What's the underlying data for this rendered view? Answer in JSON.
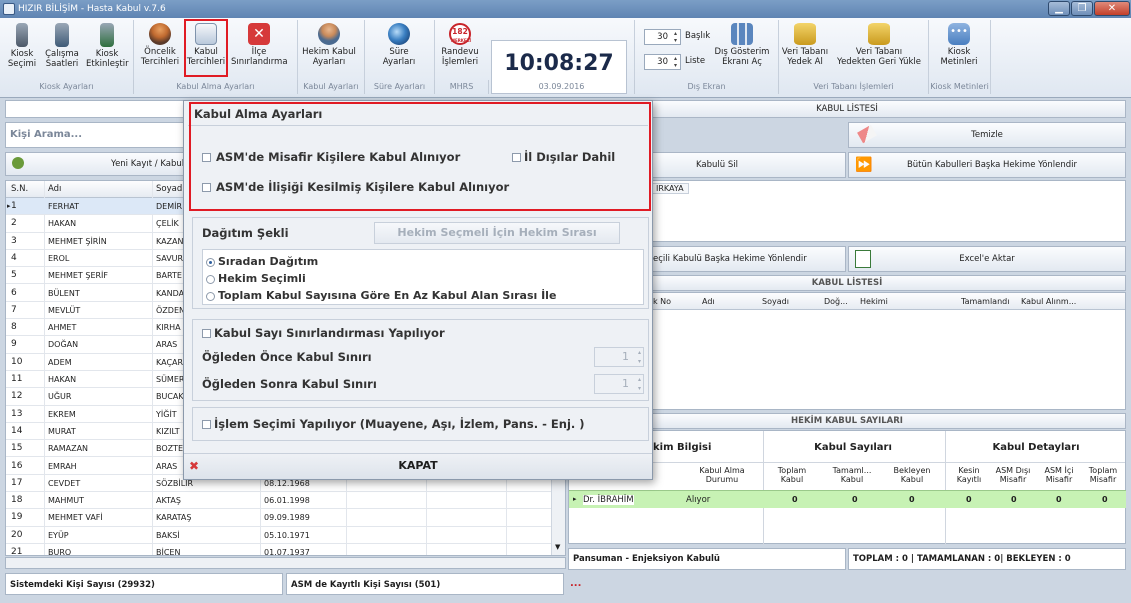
{
  "window": {
    "title": "HIZIR BİLİŞİM - Hasta Kabul v.7.6"
  },
  "ribbon": {
    "buttons": [
      {
        "label1": "Kiosk",
        "label2": "Seçimi"
      },
      {
        "label1": "Çalışma",
        "label2": "Saatleri"
      },
      {
        "label1": "Kiosk",
        "label2": "Etkinleştir"
      },
      {
        "label1": "Öncelik",
        "label2": "Tercihleri"
      },
      {
        "label1": "Kabul",
        "label2": "Tercihleri"
      },
      {
        "label1": "İlçe",
        "label2": "Sınırlandırma"
      },
      {
        "label1": "Hekim Kabul",
        "label2": "Ayarları"
      },
      {
        "label1": "Süre",
        "label2": "Ayarları"
      },
      {
        "label1": "Randevu",
        "label2": "İşlemleri"
      },
      {
        "label1": "Dış Gösterim",
        "label2": "Ekranı Aç"
      },
      {
        "label1": "Veri Tabanı",
        "label2": "Yedek Al"
      },
      {
        "label1": "Veri Tabanı",
        "label2": "Yedekten Geri Yükle"
      },
      {
        "label1": "Kiosk",
        "label2": "Metinleri"
      }
    ],
    "groups": [
      "Kiosk Ayarları",
      "Kabul Alma Ayarları",
      "Kabul Ayarları",
      "Süre Ayarları",
      "MHRS",
      "03.09.2016",
      "Dış Ekran",
      "Veri Tabanı İşlemleri",
      "Kiosk Metinleri"
    ],
    "clock": "10:08:27",
    "spin_baslik": "30",
    "baslik_label": "Başlık",
    "spin_liste": "30",
    "liste_label": "Liste",
    "randevu_badge": "182",
    "randevu_badge_sub": "MERKEZİ"
  },
  "left": {
    "search_placeholder": "Kişi Arama...",
    "new_button": "Yeni Kayıt / Kabul",
    "columns": [
      "S.N.",
      "Adı",
      "Soyadı"
    ],
    "rows": [
      {
        "sn": "1",
        "ad": "FERHAT",
        "soyad": "DEMİR",
        "dt": ""
      },
      {
        "sn": "2",
        "ad": "HAKAN",
        "soyad": "ÇELİK",
        "dt": ""
      },
      {
        "sn": "3",
        "ad": "MEHMET ŞİRİN",
        "soyad": "KAZAN",
        "dt": ""
      },
      {
        "sn": "4",
        "ad": "EROL",
        "soyad": "SAVUR",
        "dt": ""
      },
      {
        "sn": "5",
        "ad": "MEHMET ŞERİF",
        "soyad": "BARTE",
        "dt": ""
      },
      {
        "sn": "6",
        "ad": "BÜLENT",
        "soyad": "KANDA",
        "dt": ""
      },
      {
        "sn": "7",
        "ad": "MEVLÜT",
        "soyad": "ÖZDEN",
        "dt": ""
      },
      {
        "sn": "8",
        "ad": "AHMET",
        "soyad": "KIRHA",
        "dt": ""
      },
      {
        "sn": "9",
        "ad": "DOĞAN",
        "soyad": "ARAS",
        "dt": ""
      },
      {
        "sn": "10",
        "ad": "ADEM",
        "soyad": "KAÇAR",
        "dt": ""
      },
      {
        "sn": "11",
        "ad": "HAKAN",
        "soyad": "SÜMER",
        "dt": ""
      },
      {
        "sn": "12",
        "ad": "UĞUR",
        "soyad": "BUCAK",
        "dt": ""
      },
      {
        "sn": "13",
        "ad": "EKREM",
        "soyad": "YİĞİT",
        "dt": ""
      },
      {
        "sn": "14",
        "ad": "MURAT",
        "soyad": "KIZILT",
        "dt": ""
      },
      {
        "sn": "15",
        "ad": "RAMAZAN",
        "soyad": "BOZTE",
        "dt": ""
      },
      {
        "sn": "16",
        "ad": "EMRAH",
        "soyad": "ARAS",
        "dt": ""
      },
      {
        "sn": "17",
        "ad": "CEVDET",
        "soyad": "SÖZBİLİR",
        "dt": "08.12.1968"
      },
      {
        "sn": "18",
        "ad": "MAHMUT",
        "soyad": "AKTAŞ",
        "dt": "06.01.1998"
      },
      {
        "sn": "19",
        "ad": "MEHMET VAFİ",
        "soyad": "KARATAŞ",
        "dt": "09.09.1989"
      },
      {
        "sn": "20",
        "ad": "EYÜP",
        "soyad": "BAKSİ",
        "dt": "05.10.1971"
      },
      {
        "sn": "21",
        "ad": "BURO",
        "soyad": "BİCEN",
        "dt": "01.07.1937"
      }
    ],
    "status1": "Sistemdeki Kişi Sayısı (29932)",
    "status2": "ASM de Kayıtlı Kişi Sayısı (501)"
  },
  "right": {
    "list_title": "KABUL LİSTESİ",
    "clear_button": "Temizle",
    "delete_button": "Kabulü Sil",
    "redirect_all_button": "Bütün Kabulleri Başka Hekime Yönlendir",
    "selected_name": "IRKAYA",
    "redirect_sel_button": "eçili Kabulü Başka Hekime Yönlendir",
    "excel_button": "Excel'e Aktar",
    "list2_title": "KABUL LİSTESİ",
    "list2_cols": [
      "k No",
      "Adı",
      "Soyadı",
      "Doğ...",
      "Hekimi",
      "Tamamlandı",
      "Kabul Alınm..."
    ],
    "counts_title": "HEKİM KABUL SAYILARI",
    "counts_groups": [
      "kim Bilgisi",
      "Kabul Sayıları",
      "Kabul Detayları"
    ],
    "counts_cols": [
      "Kabul Alma Durumu",
      "Toplam Kabul",
      "Tamaml... Kabul",
      "Bekleyen Kabul",
      "Kesin Kayıtlı",
      "ASM Dışı Misafir",
      "ASM İçi Misafir",
      "Toplam Misafir"
    ],
    "counts_row": {
      "hekim": "Dr. İBRAHİM",
      "durum": "Alıyor",
      "v": [
        "0",
        "0",
        "0",
        "0",
        "0",
        "0",
        "0"
      ]
    },
    "footer_left": "Pansuman - Enjeksiyon Kabulü",
    "footer_right": "TOPLAM : 0 | TAMAMLANAN : 0| BEKLEYEN : 0",
    "footer_dots": "..."
  },
  "dialog": {
    "title": "Kabul Alma Ayarları",
    "opt_misafir": "ASM'de Misafir Kişilere Kabul Alınıyor",
    "opt_il_disi": "İl Dışılar Dahil",
    "opt_ilisigi": "ASM'de İlişiği Kesilmiş Kişilere Kabul Alınıyor",
    "dagitim_label": "Dağıtım Şekli",
    "hekim_sira_button": "Hekim Seçmeli İçin Hekim Sırası",
    "radio1": "Sıradan Dağıtım",
    "radio2": "Hekim Seçimli",
    "radio3": "Toplam Kabul Sayısına Göre En Az Kabul Alan Sırası İle",
    "sinir_check": "Kabul Sayı Sınırlandırması Yapılıyor",
    "once_label": "Öğleden Önce Kabul Sınırı",
    "once_value": "1",
    "sonra_label": "Öğleden Sonra Kabul Sınırı",
    "sonra_value": "1",
    "islem_check": "İşlem Seçimi Yapılıyor (Muayene, Aşı,  İzlem, Pans. - Enj. )",
    "close_button": "KAPAT"
  }
}
